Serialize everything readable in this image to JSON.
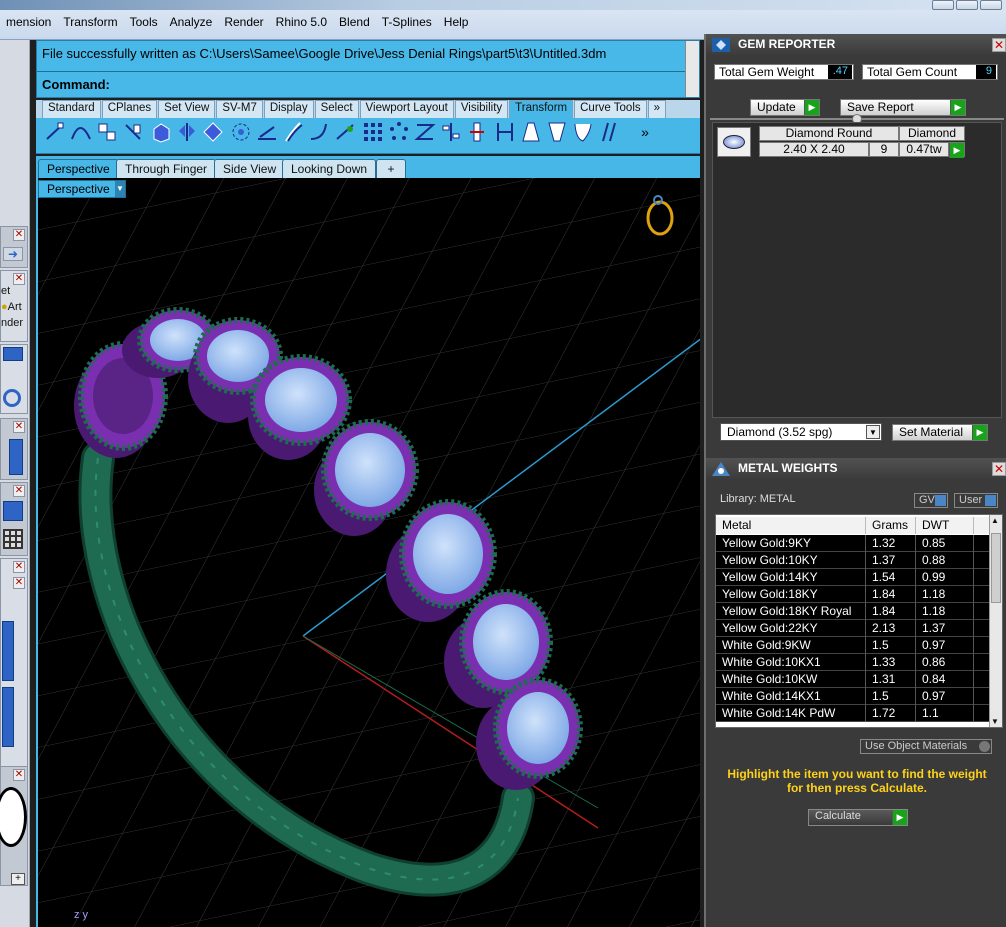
{
  "menu": {
    "items": [
      "mension",
      "Transform",
      "Tools",
      "Analyze",
      "Render",
      "Rhino 5.0",
      "Blend",
      "T-Splines",
      "Help"
    ]
  },
  "command": {
    "history": "File successfully written as C:\\Users\\Samee\\Google Drive\\Jess Denial Rings\\part5\\t3\\Untitled.3dm",
    "prompt": "Command:"
  },
  "toolbar_tabs": [
    "Standard",
    "CPlanes",
    "Set View",
    "SV-M7",
    "Display",
    "Select",
    "Viewport Layout",
    "Visibility",
    "Transform",
    "Curve Tools",
    "»"
  ],
  "active_toolbar_tab": "Transform",
  "viewport_tabs": [
    "Perspective",
    "Through Finger",
    "Side View",
    "Looking Down",
    "+"
  ],
  "viewport": {
    "label": "Perspective",
    "axis": "z y"
  },
  "left_strip": {
    "labels": [
      "et",
      "Art",
      "nder"
    ]
  },
  "gem_reporter": {
    "title": "GEM REPORTER",
    "total_weight_label": "Total Gem Weight",
    "total_weight_value": ".47",
    "total_count_label": "Total Gem Count",
    "total_count_value": "9",
    "update_label": "Update",
    "save_report_label": "Save Report",
    "gems": [
      {
        "shape": "Diamond Round",
        "material": "Diamond",
        "size": "2.40 X 2.40",
        "count": "9",
        "weight": "0.47tw"
      }
    ],
    "material_select": "Diamond     (3.52 spg)",
    "set_material_label": "Set Material"
  },
  "metal_weights": {
    "title": "METAL WEIGHTS",
    "library_label": "Library: METAL",
    "gv_label": "GV",
    "user_label": "User",
    "columns": [
      "Metal",
      "Grams",
      "DWT"
    ],
    "rows": [
      [
        "Yellow Gold:9KY",
        "1.32",
        "0.85"
      ],
      [
        "Yellow Gold:10KY",
        "1.37",
        "0.88"
      ],
      [
        "Yellow Gold:14KY",
        "1.54",
        "0.99"
      ],
      [
        "Yellow Gold:18KY",
        "1.84",
        "1.18"
      ],
      [
        "Yellow Gold:18KY Royal",
        "1.84",
        "1.18"
      ],
      [
        "Yellow Gold:22KY",
        "2.13",
        "1.37"
      ],
      [
        "White Gold:9KW",
        "1.5",
        "0.97"
      ],
      [
        "White Gold:10KX1",
        "1.33",
        "0.86"
      ],
      [
        "White Gold:10KW",
        "1.31",
        "0.84"
      ],
      [
        "White Gold:14KX1",
        "1.5",
        "0.97"
      ],
      [
        "White Gold:14K PdW",
        "1.72",
        "1.1"
      ]
    ],
    "use_object_materials_label": "Use Object Materials",
    "hint": "Highlight the item you want to find the weight for then press Calculate.",
    "calculate_label": "Calculate"
  },
  "colors": {
    "rhino_blue": "#46b7e7",
    "panel_dark": "#3a3a3a",
    "hint_yellow": "#ffd21a",
    "go_green": "#19a31a",
    "shank_green": "#1e6b52",
    "bezel_purple": "#7a2fb0",
    "gem_blue": "#9fc3f0"
  }
}
